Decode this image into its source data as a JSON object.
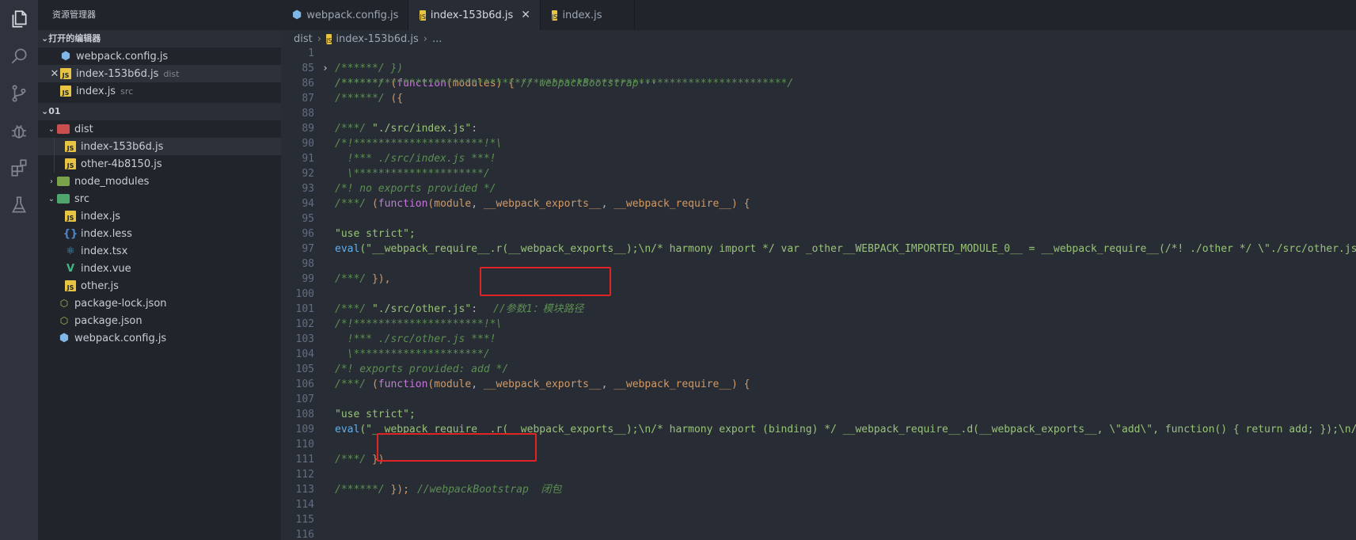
{
  "explorer": {
    "title": "资源管理器",
    "open_editors_label": "打开的编辑器",
    "open_editors": [
      {
        "name": "webpack.config.js",
        "hint": "",
        "icon": "webpack-icon"
      },
      {
        "name": "index-153b6d.js",
        "hint": "dist",
        "icon": "js-icon"
      },
      {
        "name": "index.js",
        "hint": "src",
        "icon": "js-icon"
      }
    ],
    "project_label": "01",
    "tree": [
      {
        "name": "dist",
        "type": "folder"
      },
      {
        "name": "index-153b6d.js",
        "type": "file"
      },
      {
        "name": "other-4b8150.js",
        "type": "file"
      },
      {
        "name": "node_modules",
        "type": "folder"
      },
      {
        "name": "src",
        "type": "folder"
      },
      {
        "name": "index.js",
        "type": "file"
      },
      {
        "name": "index.less",
        "type": "file"
      },
      {
        "name": "index.tsx",
        "type": "file"
      },
      {
        "name": "index.vue",
        "type": "file"
      },
      {
        "name": "other.js",
        "type": "file"
      },
      {
        "name": "package-lock.json",
        "type": "file"
      },
      {
        "name": "package.json",
        "type": "file"
      },
      {
        "name": "webpack.config.js",
        "type": "file"
      }
    ]
  },
  "tabs": [
    {
      "label": "webpack.config.js",
      "active": false
    },
    {
      "label": "index-153b6d.js",
      "active": true
    },
    {
      "label": "index.js",
      "active": false
    }
  ],
  "breadcrumb": {
    "root": "dist",
    "file": "index-153b6d.js",
    "more": "..."
  },
  "code": {
    "line_numbers": [
      "1",
      "85",
      "86",
      "87",
      "88",
      "89",
      "90",
      "91",
      "92",
      "93",
      "94",
      "95",
      "96",
      "97",
      "98",
      "99",
      "100",
      "101",
      "102",
      "103",
      "104",
      "105",
      "106",
      "107",
      "108",
      "109",
      "110",
      "111",
      "112",
      "113",
      "114",
      "115",
      "116"
    ],
    "line1_a": "/******/ ",
    "line1_b": "(",
    "line1_c": "function",
    "line1_d": "(",
    "line1_e": "modules",
    "line1_f": ") { ",
    "line1_g": "// webpackBootstrap",
    "line1_h": "···",
    "line85": "/******/ })",
    "line86": "/************************************************************************/",
    "line87_a": "/******/ ",
    "line87_b": "({",
    "line89_a": "/***/ ",
    "line89_b": "\"./src/index.js\"",
    "line89_c": ":",
    "line90": "/*!*********************!*\\",
    "line91": "  !*** ./src/index.js ***!",
    "line92": "  \\*********************/",
    "line93": "/*! no exports provided */",
    "line94_a": "/***/ ",
    "line94_b": "(",
    "line94_c": "function",
    "line94_d": "(",
    "line94_e": "module",
    "line94_f": ", ",
    "line94_g": "__webpack_exports__",
    "line94_h": ", ",
    "line94_i": "__webpack_require__",
    "line94_j": ") {",
    "line96": "\"use strict\";",
    "line97_a": "eval",
    "line97_b": "(\"__webpack_require__.r(__webpack_exports__);\\n/* harmony import */ var _other__WEBPACK_IMPORTED_MODULE_0__ = __webpack_require__(/*! ./other */ \\\"./src/other.js\\\");",
    "line99_a": "/***/ ",
    "line99_b": "}),",
    "line101_a": "/***/ ",
    "line101_b": "\"./src/other.js\"",
    "line101_c": ":",
    "line101_note": "//参数1：模块路径",
    "line102": "/*!*********************!*\\",
    "line103": "  !*** ./src/other.js ***!",
    "line104": "  \\*********************/",
    "line105": "/*! exports provided: add */",
    "line106_a": "/***/ ",
    "line106_b": "(",
    "line106_c": "function",
    "line106_d": "(",
    "line106_e": "module",
    "line106_f": ", ",
    "line106_g": "__webpack_exports__",
    "line106_h": ", ",
    "line106_i": "__webpack_require__",
    "line106_j": ") {",
    "line108": "\"use strict\";",
    "line109_a": "eval",
    "line109_b": "(\"__webpack_require__.r(__webpack_exports__);\\n/* harmony export (binding) */ __webpack_require__.d(__webpack_exports__, \\\"add\\\", function() { return add; });\\n// d",
    "line111_a": "/***/ ",
    "line111_b": "})",
    "line113_a": "/******/ ",
    "line113_b": "});",
    "line113_note": "//webpackBootstrap  闭包"
  }
}
